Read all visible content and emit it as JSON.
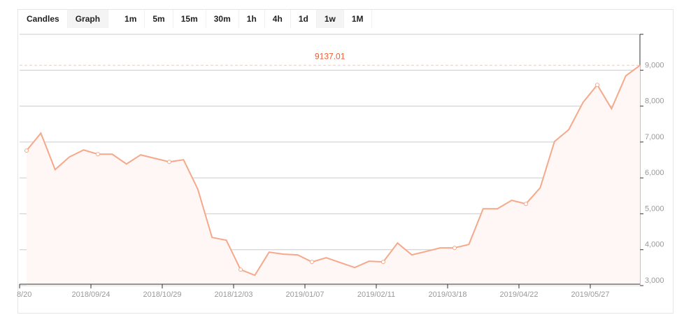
{
  "toolbar": {
    "chart_types": [
      {
        "label": "Candles",
        "active": false
      },
      {
        "label": "Graph",
        "active": true
      }
    ],
    "intervals": [
      {
        "label": "1m",
        "active": false
      },
      {
        "label": "5m",
        "active": false
      },
      {
        "label": "15m",
        "active": false
      },
      {
        "label": "30m",
        "active": false
      },
      {
        "label": "1h",
        "active": false
      },
      {
        "label": "4h",
        "active": false
      },
      {
        "label": "1d",
        "active": false
      },
      {
        "label": "1w",
        "active": true
      },
      {
        "label": "1M",
        "active": false
      }
    ]
  },
  "chart_data": {
    "type": "area",
    "current_price_label": "9137.01",
    "line_color": "#f5a98a",
    "price_label_color": "#f05a28",
    "ylim": [
      3000,
      10000
    ],
    "y_ticks": [
      {
        "v": 3000,
        "label": "3,000"
      },
      {
        "v": 4000,
        "label": "4,000"
      },
      {
        "v": 5000,
        "label": "5,000"
      },
      {
        "v": 6000,
        "label": "6,000"
      },
      {
        "v": 7000,
        "label": "7,000"
      },
      {
        "v": 8000,
        "label": "8,000"
      },
      {
        "v": 9000,
        "label": "9,000"
      }
    ],
    "x_ticks": [
      "8/20",
      "2018/09/24",
      "2018/10/29",
      "2018/12/03",
      "2019/01/07",
      "2019/02/11",
      "2019/03/18",
      "2019/04/22",
      "2019/05/27"
    ],
    "values": [
      6760,
      7246,
      6232,
      6583,
      6778,
      6661,
      6661,
      6388,
      6642,
      6544,
      6447,
      6505,
      5687,
      4342,
      4264,
      3445,
      3290,
      3933,
      3874,
      3855,
      3660,
      3777,
      3640,
      3504,
      3679,
      3660,
      4186,
      3855,
      3952,
      4050,
      4050,
      4147,
      5141,
      5141,
      5375,
      5277,
      5726,
      7012,
      7343,
      8103,
      8591,
      7928,
      8844,
      9137.01
    ],
    "grid": true,
    "y_axis": "right"
  }
}
